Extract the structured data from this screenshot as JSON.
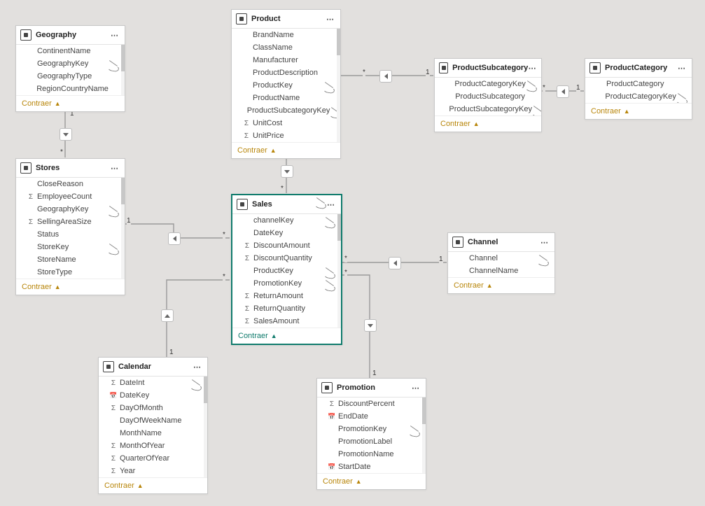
{
  "rel": {
    "one": "1",
    "many": "*"
  },
  "footer_label": "Contraer",
  "tables": [
    {
      "id": "t0",
      "name": "Geography",
      "selected": false,
      "headerHidden": false,
      "scroll": true,
      "bodyLimit": true,
      "fields": [
        {
          "name": "ContinentName"
        },
        {
          "name": "GeographyKey",
          "hidden": true
        },
        {
          "name": "GeographyType"
        },
        {
          "name": "RegionCountryName"
        }
      ]
    },
    {
      "id": "t1",
      "name": "Stores",
      "selected": false,
      "headerHidden": false,
      "scroll": true,
      "bodyLimit": true,
      "fields": [
        {
          "name": "CloseReason"
        },
        {
          "name": "EmployeeCount",
          "icon": "sigma"
        },
        {
          "name": "GeographyKey",
          "hidden": true
        },
        {
          "name": "SellingAreaSize",
          "icon": "sigma"
        },
        {
          "name": "Status"
        },
        {
          "name": "StoreKey",
          "hidden": true
        },
        {
          "name": "StoreName"
        },
        {
          "name": "StoreType"
        }
      ]
    },
    {
      "id": "t2",
      "name": "Product",
      "selected": false,
      "headerHidden": false,
      "scroll": true,
      "bodyLimit": true,
      "fields": [
        {
          "name": "BrandName"
        },
        {
          "name": "ClassName"
        },
        {
          "name": "Manufacturer"
        },
        {
          "name": "ProductDescription"
        },
        {
          "name": "ProductKey",
          "hidden": true
        },
        {
          "name": "ProductName"
        },
        {
          "name": "ProductSubcategoryKey",
          "hidden": true
        },
        {
          "name": "UnitCost",
          "icon": "sigma"
        },
        {
          "name": "UnitPrice",
          "icon": "sigma"
        }
      ]
    },
    {
      "id": "t3",
      "name": "Sales",
      "selected": true,
      "headerHidden": true,
      "scroll": true,
      "bodyLimit": true,
      "fields": [
        {
          "name": "channelKey",
          "hidden": true
        },
        {
          "name": "DateKey"
        },
        {
          "name": "DiscountAmount",
          "icon": "sigma"
        },
        {
          "name": "DiscountQuantity",
          "icon": "sigma"
        },
        {
          "name": "ProductKey",
          "hidden": true
        },
        {
          "name": "PromotionKey",
          "hidden": true
        },
        {
          "name": "ReturnAmount",
          "icon": "sigma"
        },
        {
          "name": "ReturnQuantity",
          "icon": "sigma"
        },
        {
          "name": "SalesAmount",
          "icon": "sigma"
        }
      ]
    },
    {
      "id": "t4",
      "name": "ProductSubcategory",
      "selected": false,
      "headerHidden": false,
      "scroll": false,
      "bodyLimit": false,
      "fields": [
        {
          "name": "ProductCategoryKey",
          "hidden": true
        },
        {
          "name": "ProductSubcategory"
        },
        {
          "name": "ProductSubcategoryKey",
          "hidden": true
        }
      ]
    },
    {
      "id": "t5",
      "name": "ProductCategory",
      "selected": false,
      "headerHidden": false,
      "scroll": false,
      "bodyLimit": false,
      "fields": [
        {
          "name": "ProductCategory"
        },
        {
          "name": "ProductCategoryKey",
          "hidden": true
        }
      ]
    },
    {
      "id": "t6",
      "name": "Channel",
      "selected": false,
      "headerHidden": false,
      "scroll": false,
      "bodyLimit": false,
      "fields": [
        {
          "name": "Channel",
          "hidden": true
        },
        {
          "name": "ChannelName"
        }
      ]
    },
    {
      "id": "t7",
      "name": "Calendar",
      "selected": false,
      "headerHidden": false,
      "scroll": true,
      "bodyLimit": false,
      "fields": [
        {
          "name": "DateInt",
          "icon": "sigma",
          "hidden": true
        },
        {
          "name": "DateKey",
          "icon": "cal"
        },
        {
          "name": "DayOfMonth",
          "icon": "sigma"
        },
        {
          "name": "DayOfWeekName"
        },
        {
          "name": "MonthName"
        },
        {
          "name": "MonthOfYear",
          "icon": "sigma"
        },
        {
          "name": "QuarterOfYear",
          "icon": "sigma"
        },
        {
          "name": "Year",
          "icon": "sigma"
        }
      ]
    },
    {
      "id": "t8",
      "name": "Promotion",
      "selected": false,
      "headerHidden": false,
      "scroll": true,
      "bodyLimit": false,
      "fields": [
        {
          "name": "DiscountPercent",
          "icon": "sigma"
        },
        {
          "name": "EndDate",
          "icon": "cal"
        },
        {
          "name": "PromotionKey",
          "hidden": true
        },
        {
          "name": "PromotionLabel"
        },
        {
          "name": "PromotionName"
        },
        {
          "name": "StartDate",
          "icon": "cal"
        }
      ]
    }
  ]
}
